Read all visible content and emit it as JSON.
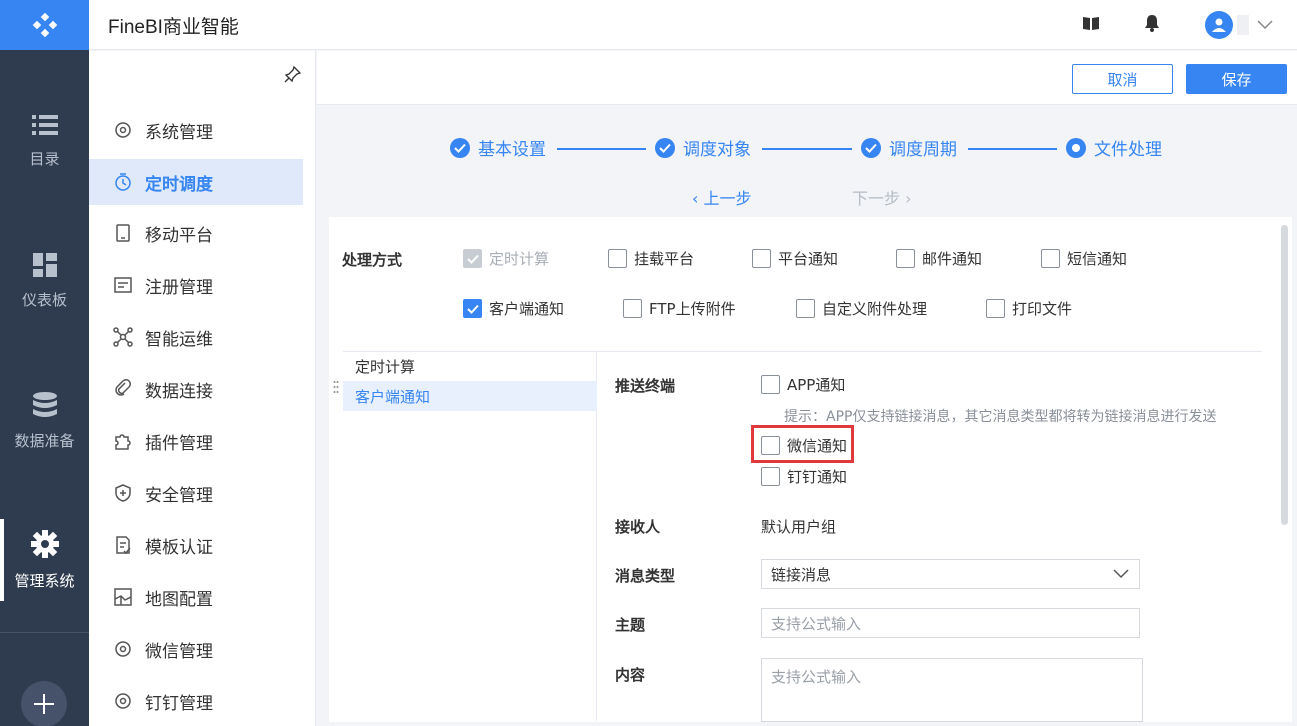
{
  "app": {
    "title": "FineBI商业智能"
  },
  "rail": {
    "items": [
      {
        "label": "目录",
        "icon": "list-icon"
      },
      {
        "label": "仪表板",
        "icon": "dashboard-icon"
      },
      {
        "label": "数据准备",
        "icon": "database-icon"
      },
      {
        "label": "管理系统",
        "icon": "gear-icon",
        "active": true
      }
    ]
  },
  "menu": {
    "items": [
      {
        "label": "系统管理",
        "icon": "gear-icon"
      },
      {
        "label": "定时调度",
        "icon": "timer-icon",
        "active": true
      },
      {
        "label": "移动平台",
        "icon": "mobile-icon"
      },
      {
        "label": "注册管理",
        "icon": "register-icon"
      },
      {
        "label": "智能运维",
        "icon": "network-icon"
      },
      {
        "label": "数据连接",
        "icon": "link-icon"
      },
      {
        "label": "插件管理",
        "icon": "puzzle-icon"
      },
      {
        "label": "安全管理",
        "icon": "shield-icon"
      },
      {
        "label": "模板认证",
        "icon": "template-icon"
      },
      {
        "label": "地图配置",
        "icon": "map-icon"
      },
      {
        "label": "微信管理",
        "icon": "gear-icon"
      },
      {
        "label": "钉钉管理",
        "icon": "gear-icon"
      }
    ]
  },
  "actions": {
    "cancel": "取消",
    "save": "保存"
  },
  "steps": [
    {
      "label": "基本设置",
      "state": "done"
    },
    {
      "label": "调度对象",
      "state": "done"
    },
    {
      "label": "调度周期",
      "state": "done"
    },
    {
      "label": "文件处理",
      "state": "current"
    }
  ],
  "nav": {
    "prev": "上一步",
    "next": "下一步"
  },
  "form": {
    "process_label": "处理方式",
    "options_row1": [
      {
        "label": "定时计算",
        "checked": true,
        "disabled": true
      },
      {
        "label": "挂载平台",
        "checked": false
      },
      {
        "label": "平台通知",
        "checked": false
      },
      {
        "label": "邮件通知",
        "checked": false
      },
      {
        "label": "短信通知",
        "checked": false
      }
    ],
    "options_row2": [
      {
        "label": "客户端通知",
        "checked": true
      },
      {
        "label": "FTP上传附件",
        "checked": false
      },
      {
        "label": "自定义附件处理",
        "checked": false
      },
      {
        "label": "打印文件",
        "checked": false
      }
    ],
    "subnav": [
      {
        "label": "定时计算"
      },
      {
        "label": "客户端通知",
        "active": true
      }
    ],
    "push_label": "推送终端",
    "push_options": [
      {
        "label": "APP通知",
        "checked": false
      },
      {
        "label": "微信通知",
        "checked": false,
        "highlighted": true
      },
      {
        "label": "钉钉通知",
        "checked": false
      }
    ],
    "push_hint": "提示：APP仅支持链接消息，其它消息类型都将转为链接消息进行发送",
    "receiver_label": "接收人",
    "receiver_value": "默认用户组",
    "msgtype_label": "消息类型",
    "msgtype_value": "链接消息",
    "subject_label": "主题",
    "subject_placeholder": "支持公式输入",
    "content_label": "内容",
    "content_placeholder": "支持公式输入"
  },
  "colors": {
    "accent": "#3685f2",
    "rail_bg": "#2f3b4f",
    "highlight": "#e0393b"
  }
}
